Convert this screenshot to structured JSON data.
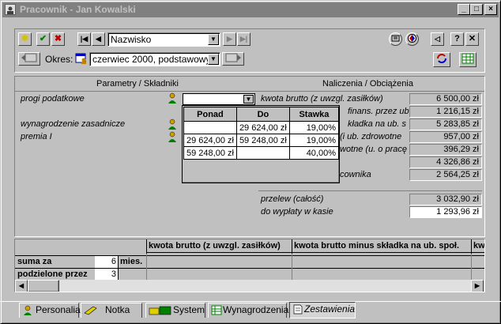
{
  "window": {
    "title": "Pracownik - Jan Kowalski",
    "controls": [
      "_",
      "□",
      "×"
    ]
  },
  "toolbar": {
    "sort_field": "Nazwisko",
    "period_label": "Okres:",
    "period_value": "czerwiec 2000, podstawowy"
  },
  "headers": {
    "left": "Parametry / Składniki",
    "right": "Naliczenia / Obciążenia"
  },
  "params": [
    {
      "label": "progi podatkowe"
    },
    {
      "label": "wynagrodzenie zasadnicze"
    },
    {
      "label": "premia I"
    }
  ],
  "charges": [
    {
      "label": "kwota brutto (z uwzgl. zasiłków)",
      "value": "6 500,00 zł"
    },
    {
      "label": "finans. przez ub",
      "value": "1 216,15 zł"
    },
    {
      "label": "kładka na ub. s",
      "value": "5 283,85 zł"
    },
    {
      "label": "(i ub. zdrowotne",
      "value": "957,00 zł"
    },
    {
      "label": "wotne (u. o pracę",
      "value": "396,29 zł"
    },
    {
      "label": "",
      "value": "4 326,86 zł"
    },
    {
      "label": "cownika",
      "value": "2 564,25 zł"
    }
  ],
  "transfers": [
    {
      "label": "przelew (całość)",
      "value": "3 032,90 zł"
    },
    {
      "label": "do wypłaty w kasie",
      "value": "1 293,96 zł"
    }
  ],
  "popup": {
    "headers": [
      "Ponad",
      "Do",
      "Stawka"
    ],
    "rows": [
      [
        "",
        "29 624,00 zł",
        "19,00%"
      ],
      [
        "29 624,00 zł",
        "59 248,00 zł",
        "19,00%"
      ],
      [
        "59 248,00 zł",
        "",
        "40,00%"
      ]
    ]
  },
  "grid": {
    "columns": [
      "kwota brutto (z uwzgl. zasiłków)",
      "kwota brutto minus składka na ub. społ.",
      "kw"
    ],
    "rows": [
      {
        "label": "suma za",
        "value": "6",
        "unit": "mies."
      },
      {
        "label": "podzielone przez",
        "value": "3",
        "unit": ""
      }
    ]
  },
  "tabs": [
    "Personalia",
    "Notka",
    "System",
    "Wynagrodzenia",
    "Zestawienia"
  ],
  "active_tab": "Zestawienia",
  "colors": {
    "title_inactive": "#808080",
    "face": "#c0c0c0"
  }
}
